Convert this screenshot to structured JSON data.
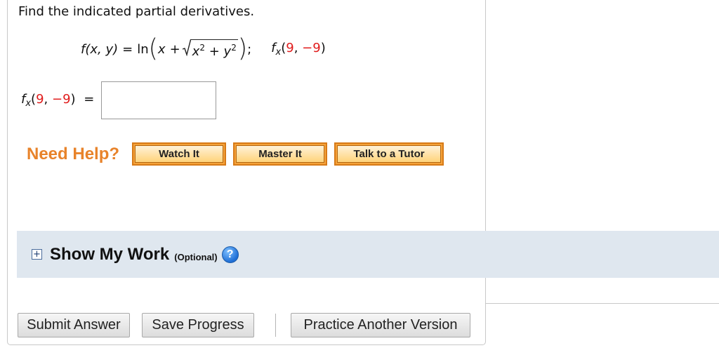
{
  "question": {
    "prompt": "Find the indicated partial derivatives.",
    "function_lhs": "f(x, y)",
    "equals": "=",
    "ln": "ln",
    "inner_x": "x",
    "plus": "+",
    "radicand": {
      "x": "x",
      "x_exp": "2",
      "plus": "+",
      "y": "y",
      "y_exp": "2"
    },
    "separator": ";",
    "target_f": "f",
    "target_sub": "x",
    "target_point_open": "(",
    "target_point_x": "9",
    "target_point_comma": ", ",
    "target_point_y": "−9",
    "target_point_close": ")"
  },
  "answer": {
    "label_f": "f",
    "label_sub": "x",
    "label_open": "(",
    "label_x": "9",
    "label_comma": ", ",
    "label_y": "−9",
    "label_close": ")",
    "label_equals": "=",
    "value": "",
    "placeholder": ""
  },
  "help": {
    "label": "Need Help?",
    "buttons": [
      "Watch It",
      "Master It",
      "Talk to a Tutor"
    ]
  },
  "show_work": {
    "expand_icon_glyph": "+",
    "title": "Show My Work",
    "optional": "(Optional)",
    "help_glyph": "?"
  },
  "actions": {
    "submit": "Submit Answer",
    "save": "Save Progress",
    "practice": "Practice Another Version"
  },
  "colors": {
    "accent_red": "#e01b1b",
    "help_orange": "#e8832a",
    "work_bar_bg": "#dfe7ef"
  }
}
